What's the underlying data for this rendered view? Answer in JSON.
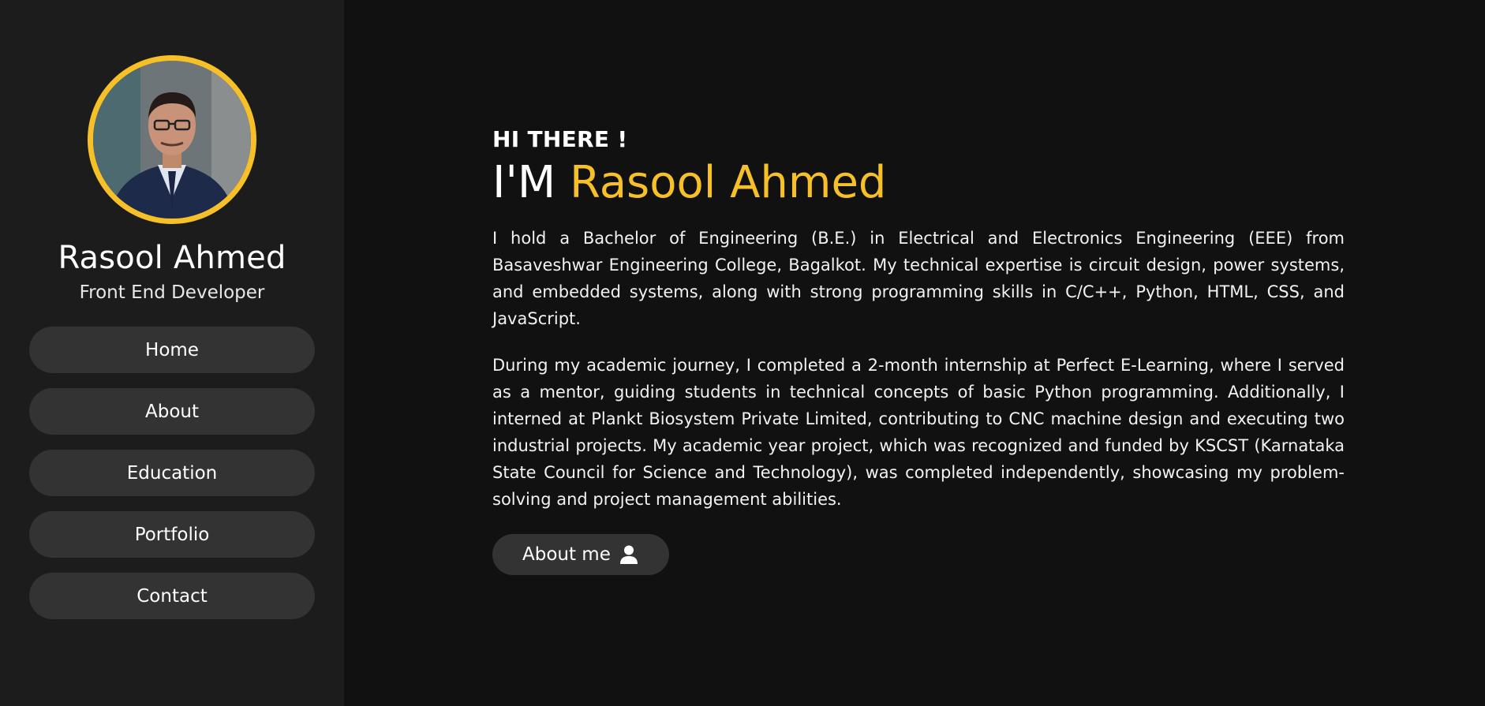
{
  "sidebar": {
    "name": "Rasool Ahmed",
    "role": "Front End Developer",
    "nav": [
      {
        "label": "Home"
      },
      {
        "label": "About"
      },
      {
        "label": "Education"
      },
      {
        "label": "Portfolio"
      },
      {
        "label": "Contact"
      }
    ]
  },
  "main": {
    "greeting": "HI THERE !",
    "headline_prefix": "I'M",
    "headline_name": "Rasool Ahmed",
    "paragraphs": [
      "I hold a Bachelor of Engineering (B.E.) in Electrical and Electronics Engineering (EEE) from Basaveshwar Engineering College, Bagalkot. My technical expertise is circuit design, power systems, and embedded systems, along with strong programming skills in C/C++, Python, HTML, CSS, and JavaScript.",
      "During my academic journey, I completed a 2-month internship at Perfect E-Learning, where I served as a mentor, guiding students in technical concepts of basic Python programming. Additionally, I interned at Plankt Biosystem Private Limited, contributing to CNC machine design and executing two industrial projects. My academic year project, which was recognized and funded by KSCST (Karnataka State Council for Science and Technology), was completed independently, showcasing my problem-solving and project management abilities."
    ],
    "about_button": {
      "label": "About me",
      "icon": "user-icon"
    }
  },
  "colors": {
    "accent": "#f6c026",
    "background": "#111111",
    "sidebar": "#1c1c1c",
    "button": "#333333"
  }
}
